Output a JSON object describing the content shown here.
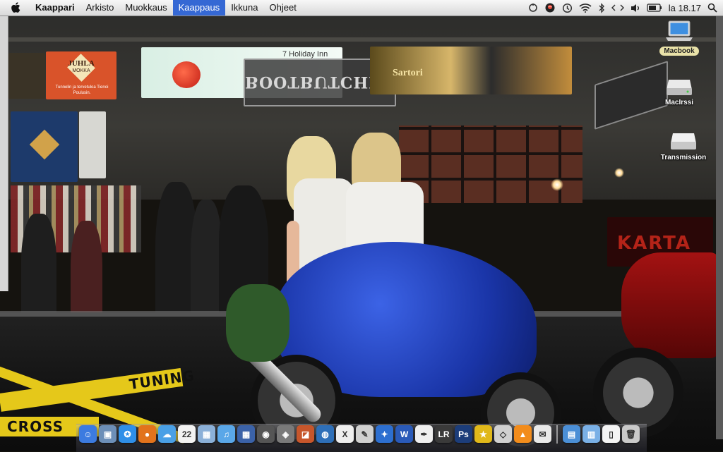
{
  "menubar": {
    "app_name": "Kaappari",
    "items": [
      "Arkisto",
      "Muokkaus",
      "Kaappaus",
      "Ikkuna",
      "Ohjeet"
    ],
    "active_item": "Kaappaus",
    "clock": "la 18.17"
  },
  "wallpaper": {
    "signs": {
      "juhla_line1": "JUHLA",
      "juhla_line2": "MOKKA",
      "juhla_caption": "Tunnelin ja tervetuloa Tienoi Poulusin.",
      "holiday_inn": "7 Holiday Inn",
      "banner_text": "BOOTBUTCHERY",
      "sartori": "Sartori",
      "karta": "KARTA",
      "tuning": "TUNING",
      "cross": "CROSS"
    }
  },
  "desktop_icons": [
    {
      "name": "Macbook",
      "selected": true
    },
    {
      "name": "MacIrssi",
      "selected": false
    },
    {
      "name": "Transmission",
      "selected": false
    }
  ],
  "dock": {
    "apps": [
      {
        "icon": "finder-icon",
        "color": "#3c7be0",
        "glyph": "☺"
      },
      {
        "icon": "preview-icon",
        "color": "#6d8fb8",
        "glyph": "▣"
      },
      {
        "icon": "safari-icon",
        "color": "#2f8fe8",
        "glyph": "✪"
      },
      {
        "icon": "firefox-icon",
        "color": "#e2731c",
        "glyph": "●"
      },
      {
        "icon": "ichat-icon",
        "color": "#4aa0e6",
        "glyph": "☁"
      },
      {
        "icon": "ical-icon",
        "color": "#f2f2f2",
        "glyph": "22"
      },
      {
        "icon": "iphoto-icon",
        "color": "#8bb0d8",
        "glyph": "▦"
      },
      {
        "icon": "itunes-icon",
        "color": "#5aa7e8",
        "glyph": "♫"
      },
      {
        "icon": "spaces-icon",
        "color": "#3b62a8",
        "glyph": "▦"
      },
      {
        "icon": "dvd-player-icon",
        "color": "#555555",
        "glyph": "◉"
      },
      {
        "icon": "image-capture-icon",
        "color": "#7a7a7a",
        "glyph": "◈"
      },
      {
        "icon": "photo-booth-icon",
        "color": "#c7562b",
        "glyph": "◪"
      },
      {
        "icon": "network-icon",
        "color": "#2e6fb8",
        "glyph": "◍"
      },
      {
        "icon": "x11-icon",
        "color": "#eeeeee",
        "glyph": "X"
      },
      {
        "icon": "script-editor-icon",
        "color": "#d0d0d0",
        "glyph": "✎"
      },
      {
        "icon": "adium-icon",
        "color": "#2d6fd0",
        "glyph": "✦"
      },
      {
        "icon": "word-icon",
        "color": "#2a5ab8",
        "glyph": "W"
      },
      {
        "icon": "textedit-icon",
        "color": "#efefef",
        "glyph": "✒"
      },
      {
        "icon": "lightroom-icon",
        "color": "#3a3a3a",
        "glyph": "LR"
      },
      {
        "icon": "photoshop-icon",
        "color": "#1c3d7a",
        "glyph": "Ps"
      },
      {
        "icon": "star-icon",
        "color": "#e0b81a",
        "glyph": "★"
      },
      {
        "icon": "cyberduck-icon",
        "color": "#d0d0d0",
        "glyph": "◇"
      },
      {
        "icon": "vlc-icon",
        "color": "#f28c1c",
        "glyph": "▲"
      },
      {
        "icon": "terminal-icon",
        "color": "#e9e9e9",
        "glyph": "✉"
      }
    ],
    "stacks": [
      {
        "icon": "applications-stack-icon",
        "color": "#4b8fd6",
        "glyph": "▤"
      },
      {
        "icon": "downloads-stack-icon",
        "color": "#7ab0e6",
        "glyph": "▥"
      },
      {
        "icon": "documents-stack-icon",
        "color": "#f4f4f4",
        "glyph": "▯"
      },
      {
        "icon": "trash-icon",
        "color": "#c9c9c9",
        "glyph": "🗑"
      }
    ]
  }
}
